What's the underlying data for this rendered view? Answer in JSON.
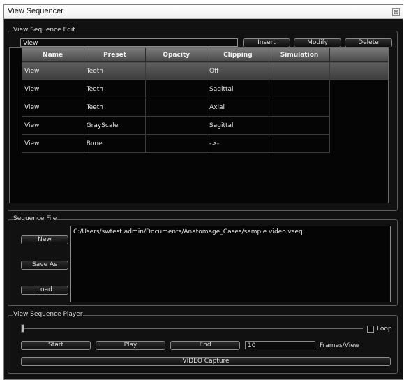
{
  "window": {
    "title": "View Sequencer",
    "close_glyph": "⊠"
  },
  "edit": {
    "group_label": "View Sequence Edit",
    "name_value": "View",
    "insert_label": "Insert",
    "modify_label": "Modify",
    "delete_label": "Delete"
  },
  "table": {
    "columns": [
      "Name",
      "Preset",
      "Opacity",
      "Clipping",
      "Simulation"
    ],
    "rows": [
      {
        "name": "View",
        "preset": "Teeth",
        "opacity": "",
        "clipping": "Off",
        "simulation": ""
      },
      {
        "name": "View",
        "preset": "Teeth",
        "opacity": "",
        "clipping": "Sagittal",
        "simulation": ""
      },
      {
        "name": "View",
        "preset": "Teeth",
        "opacity": "",
        "clipping": "Axial",
        "simulation": ""
      },
      {
        "name": "View",
        "preset": "GrayScale",
        "opacity": "",
        "clipping": "Sagittal",
        "simulation": ""
      },
      {
        "name": "View",
        "preset": "Bone",
        "opacity": "",
        "clipping": "->-",
        "simulation": ""
      }
    ]
  },
  "file": {
    "group_label": "Sequence File",
    "new_label": "New",
    "saveas_label": "Save As",
    "load_label": "Load",
    "path": "C:/Users/swtest.admin/Documents/Anatomage_Cases/sample video.vseq"
  },
  "player": {
    "group_label": "View Sequence Player",
    "loop_label": "Loop",
    "start_label": "Start",
    "play_label": "Play",
    "end_label": "End",
    "frames_value": "10",
    "frames_label": "Frames/View",
    "capture_label": "VIDEO Capture"
  }
}
